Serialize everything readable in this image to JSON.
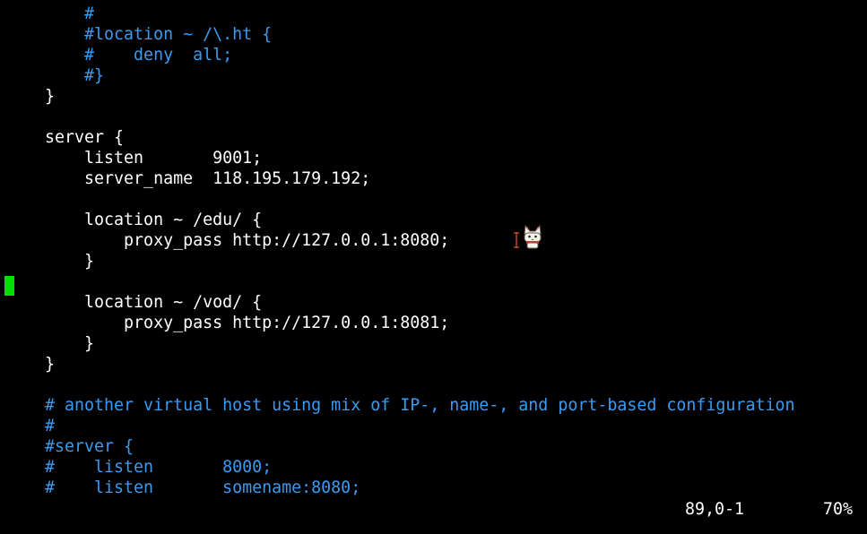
{
  "editor": {
    "lines": [
      {
        "text": "    #",
        "comment": true
      },
      {
        "text": "    #location ~ /\\.ht {",
        "comment": true
      },
      {
        "text": "    #    deny  all;",
        "comment": true
      },
      {
        "text": "    #}",
        "comment": true
      },
      {
        "text": "}",
        "comment": false
      },
      {
        "text": "",
        "comment": false
      },
      {
        "text": "server {",
        "comment": false
      },
      {
        "text": "    listen       9001;",
        "comment": false
      },
      {
        "text": "    server_name  118.195.179.192;",
        "comment": false
      },
      {
        "text": "",
        "comment": false
      },
      {
        "text": "    location ~ /edu/ {",
        "comment": false
      },
      {
        "text": "        proxy_pass http://127.0.0.1:8080;",
        "comment": false
      },
      {
        "text": "    }",
        "comment": false
      },
      {
        "text": "",
        "comment": false
      },
      {
        "text": "    location ~ /vod/ {",
        "comment": false
      },
      {
        "text": "        proxy_pass http://127.0.0.1:8081;",
        "comment": false
      },
      {
        "text": "    }",
        "comment": false
      },
      {
        "text": "}",
        "comment": false
      },
      {
        "text": "",
        "comment": false
      },
      {
        "text": "# another virtual host using mix of IP-, name-, and port-based configuration",
        "comment": true
      },
      {
        "text": "#",
        "comment": true
      },
      {
        "text": "#server {",
        "comment": true
      },
      {
        "text": "#    listen       8000;",
        "comment": true
      },
      {
        "text": "#    listen       somename:8080;",
        "comment": true
      }
    ]
  },
  "status": {
    "position": "89,0-1",
    "percent": "70%"
  },
  "colors": {
    "background": "#000000",
    "text": "#ffffff",
    "comment": "#3a9bf0",
    "cursor": "#00e000"
  },
  "icons": {
    "mouse": "i-beam-cursor-icon",
    "overlay": "cat-icon"
  }
}
